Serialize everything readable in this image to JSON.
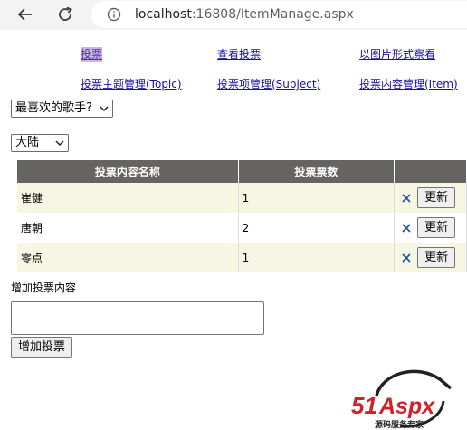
{
  "browser": {
    "url_host": "localhost",
    "url_rest": ":16808/ItemManage.aspx"
  },
  "nav": {
    "links": [
      {
        "label": "投票"
      },
      {
        "label": "查看投票"
      },
      {
        "label": "以图片形式察看"
      },
      {
        "label": "投票主题管理(Topic)"
      },
      {
        "label": "投票项管理(Subject)"
      },
      {
        "label": "投票内容管理(Item)"
      }
    ]
  },
  "subject_select": {
    "value": "最喜欢的歌手?"
  },
  "region_select": {
    "value": "大陆"
  },
  "grid": {
    "headers": [
      "投票内容名称",
      "投票票数",
      ""
    ],
    "rows": [
      {
        "name": "崔健",
        "count": "1",
        "button": "更新"
      },
      {
        "name": "唐朝",
        "count": "2",
        "button": "更新"
      },
      {
        "name": "零点",
        "count": "1",
        "button": "更新"
      }
    ]
  },
  "add_section": {
    "label": "增加投票内容",
    "input_value": "",
    "button": "增加投票"
  },
  "logo": {
    "text": "51Aspx",
    "tagline": "源码服务专家"
  },
  "colors": {
    "link": "#1a0dab",
    "grid_header": "#666463",
    "grid_row_alt": "#f6f6e5",
    "logo_red": "#d3202a"
  }
}
